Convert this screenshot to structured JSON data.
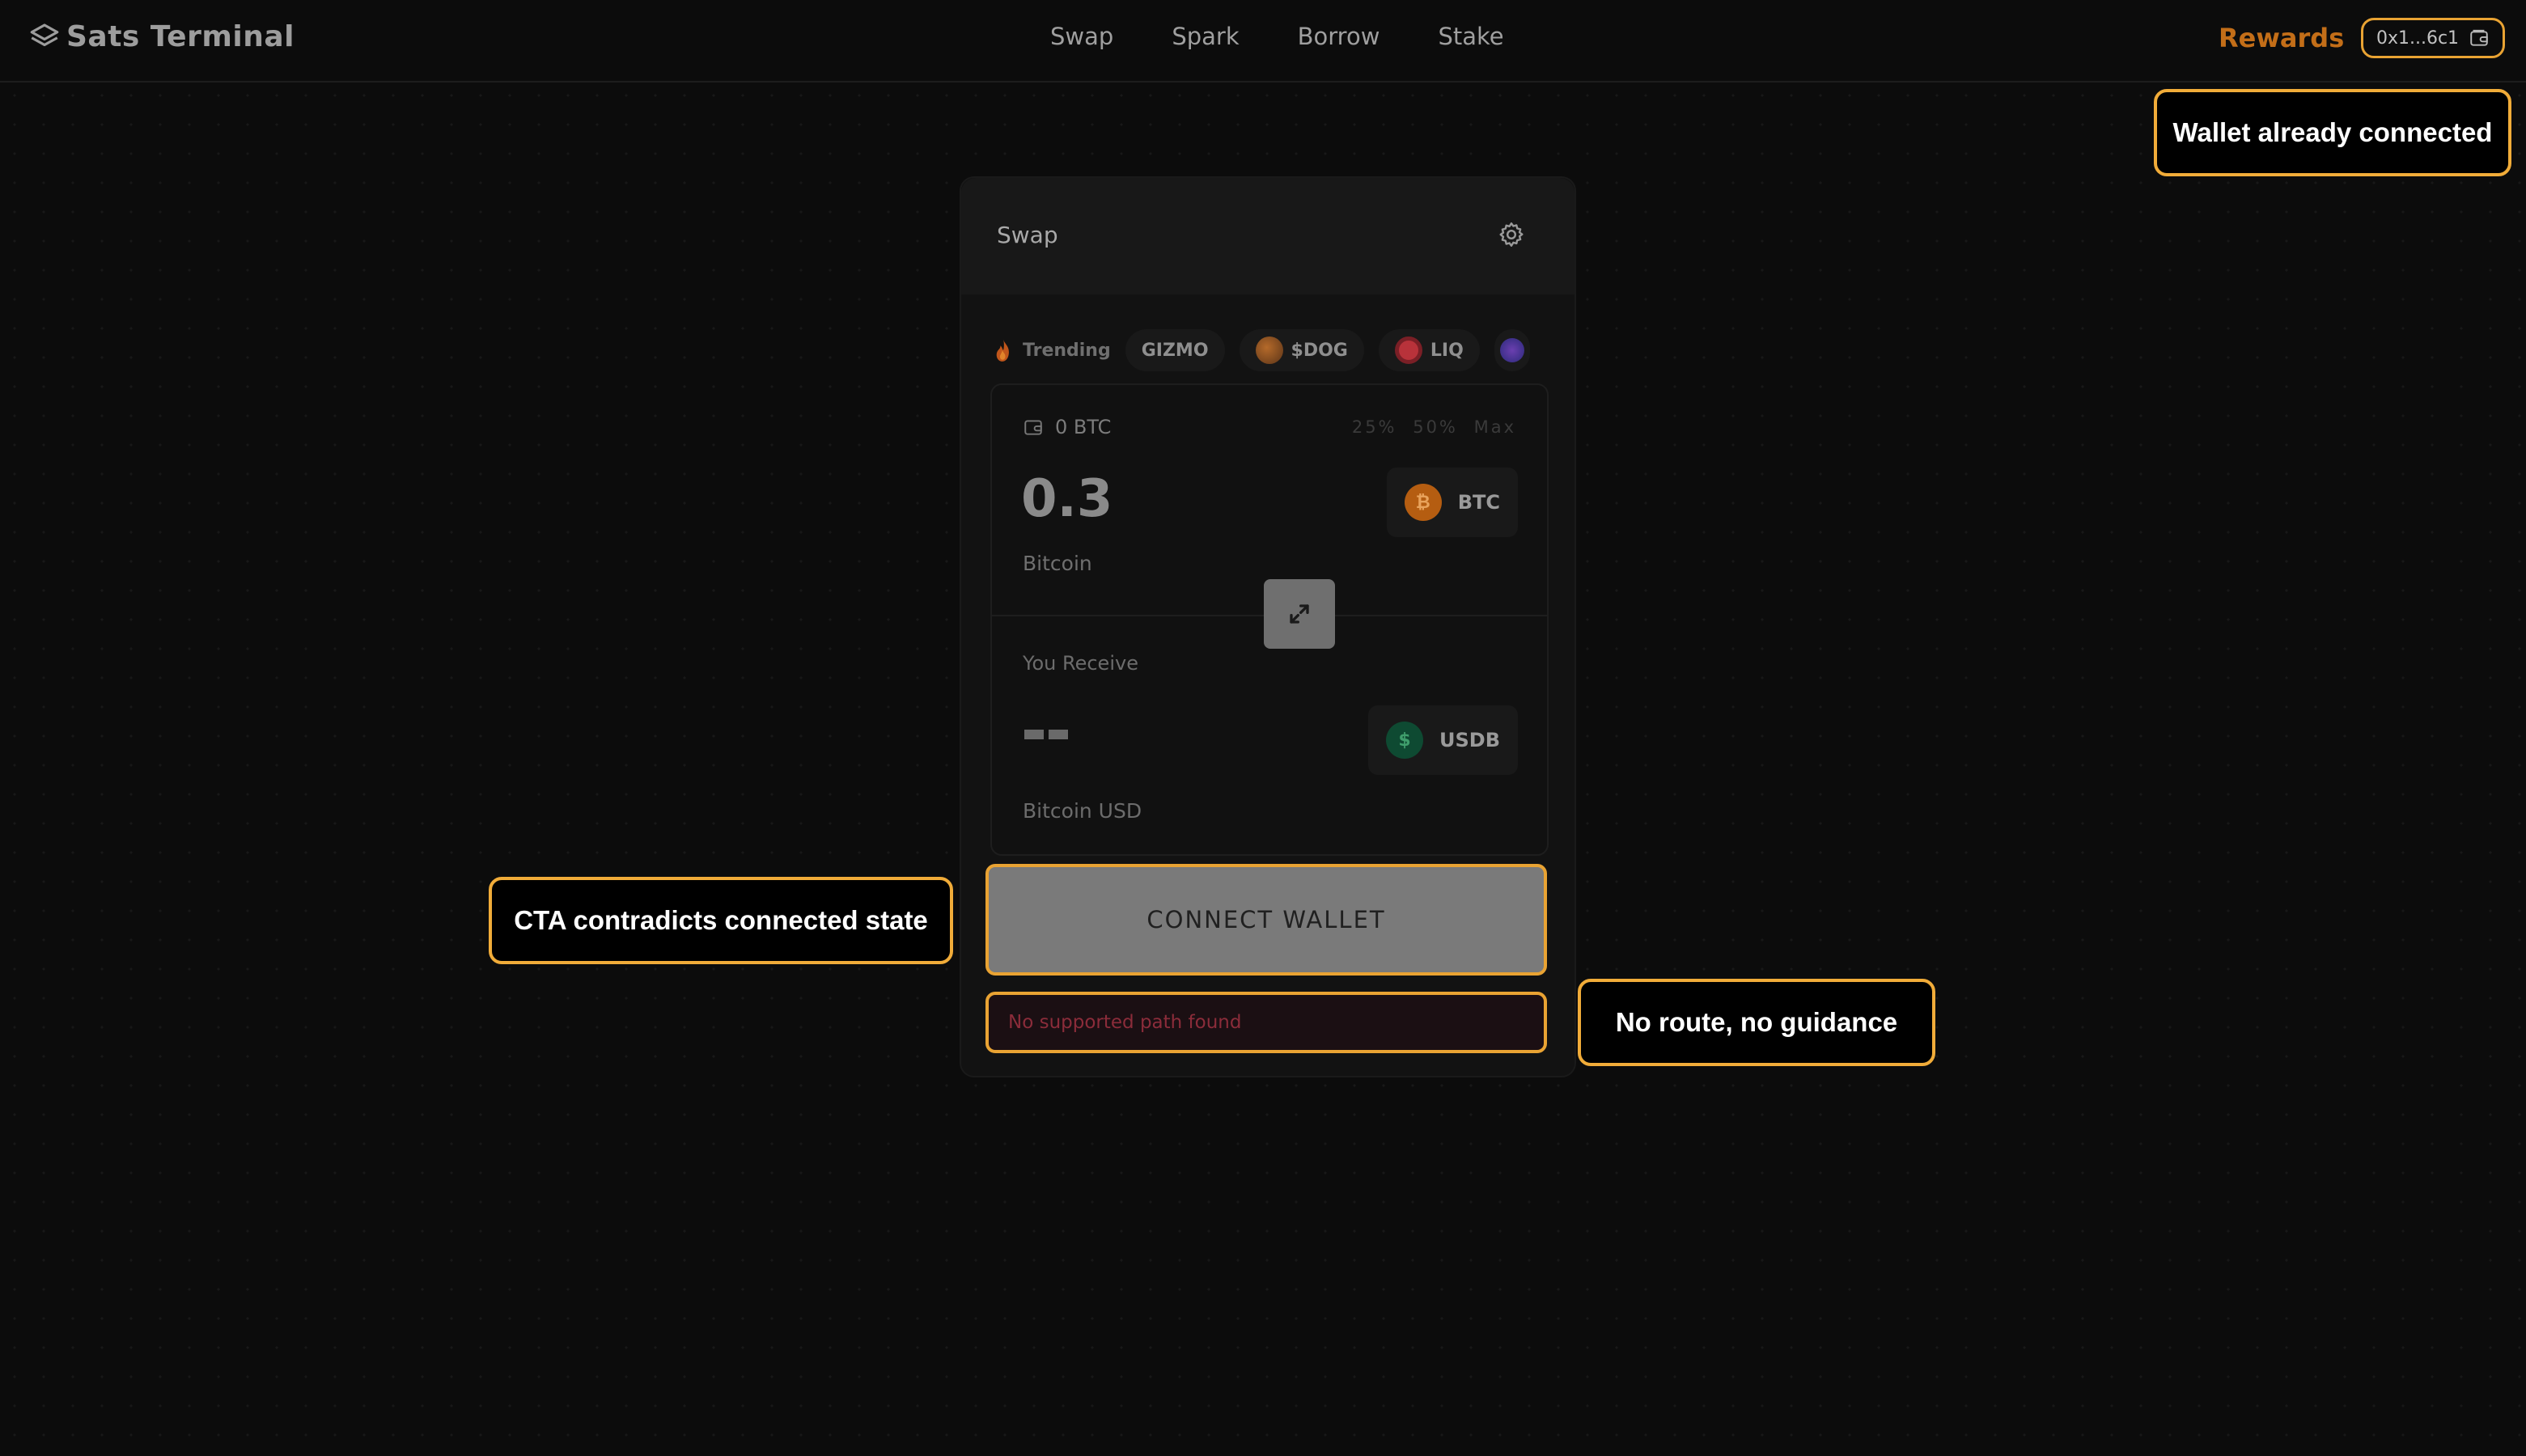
{
  "nav": {
    "brand": "Sats Terminal",
    "links": [
      "Swap",
      "Spark",
      "Borrow",
      "Stake"
    ],
    "rewards": "Rewards",
    "wallet_address": "0x1...6c1"
  },
  "swap_card": {
    "title": "Swap",
    "trending": {
      "label": "Trending",
      "chips": [
        "GIZMO",
        "$DOG",
        "LIQ"
      ]
    },
    "pay": {
      "balance": "0 BTC",
      "percent_options": [
        "25%",
        "50%",
        "Max"
      ],
      "amount": "0.3",
      "asset_name": "Bitcoin",
      "token_symbol": "BTC",
      "token_glyph": "₿"
    },
    "receive": {
      "label": "You Receive",
      "asset_name": "Bitcoin USD",
      "token_symbol": "USDB",
      "token_glyph": "$"
    },
    "cta": "CONNECT WALLET",
    "error": "No supported path found"
  },
  "annotations": {
    "wallet_connected": "Wallet already connected",
    "cta_contradiction": "CTA contradicts connected state",
    "no_route": "No route, no guidance"
  },
  "colors": {
    "accent_orange": "#c36e18",
    "highlight_outline": "#e9a333",
    "error_text": "#8b2c3a"
  }
}
